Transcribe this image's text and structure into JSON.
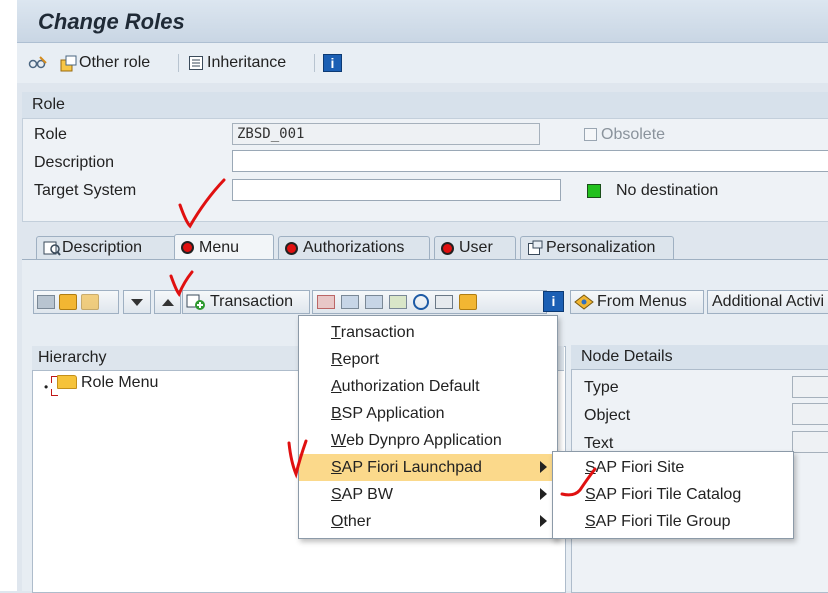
{
  "window": {
    "title": "Change Roles"
  },
  "toolbar": {
    "other_role": "Other role",
    "inheritance": "Inheritance",
    "info_glyph": "i"
  },
  "role_section": {
    "header": "Role",
    "role_label": "Role",
    "role_value": "ZBSD_001",
    "obsolete_label": "Obsolete",
    "description_label": "Description",
    "description_value": "",
    "target_system_label": "Target System",
    "target_system_value": "",
    "destination_status": "No destination",
    "status_color": "#22c01e"
  },
  "tabs": [
    {
      "label": "Description",
      "icon": "description-icon"
    },
    {
      "label": "Menu",
      "icon": "red-status-icon",
      "active": true
    },
    {
      "label": "Authorizations",
      "icon": "red-status-icon"
    },
    {
      "label": "User",
      "icon": "red-status-icon"
    },
    {
      "label": "Personalization",
      "icon": "personalization-icon"
    }
  ],
  "menu_toolbar": {
    "transaction": "Transaction",
    "from_menus": "From Menus",
    "additional_activities": "Additional Activi"
  },
  "hierarchy": {
    "header": "Hierarchy",
    "root": "Role Menu"
  },
  "node_details": {
    "header": "Node Details",
    "type_label": "Type",
    "object_label": "Object",
    "text_label": "Text"
  },
  "context_menu": {
    "items": [
      {
        "label": "Transaction",
        "mnemonic": "T"
      },
      {
        "label": "Report",
        "mnemonic": "R"
      },
      {
        "label": "Authorization Default",
        "mnemonic": "A"
      },
      {
        "label": "BSP Application",
        "mnemonic": "B"
      },
      {
        "label": "Web Dynpro Application",
        "mnemonic": "W"
      },
      {
        "label": "SAP Fiori Launchpad",
        "mnemonic": "S",
        "submenu": true,
        "highlighted": true
      },
      {
        "label": "SAP BW",
        "mnemonic": "S",
        "submenu": true
      },
      {
        "label": "Other",
        "mnemonic": "O",
        "submenu": true
      }
    ]
  },
  "submenu": {
    "items": [
      {
        "label": "SAP Fiori Site"
      },
      {
        "label": "SAP Fiori Tile Catalog"
      },
      {
        "label": "SAP Fiori Tile Group"
      }
    ]
  },
  "colors": {
    "highlight": "#fbd98b",
    "annotation": "#e01010"
  }
}
